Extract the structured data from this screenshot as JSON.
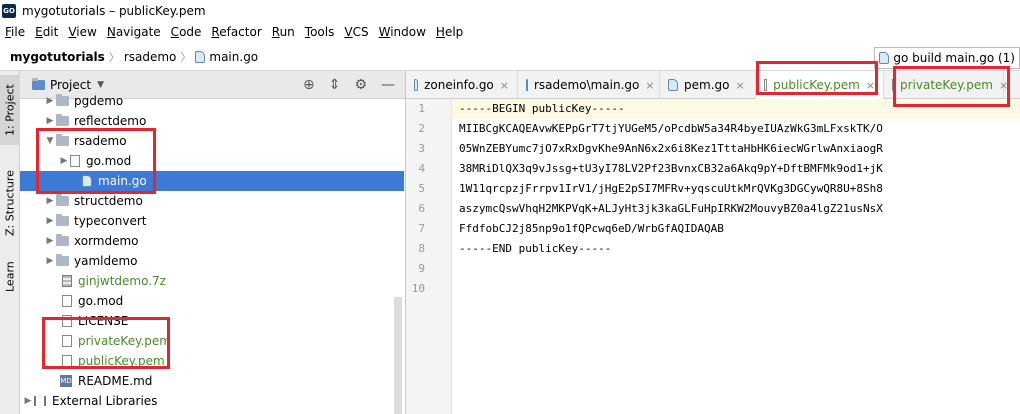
{
  "window": {
    "title": "mygotutorials – publicKey.pem",
    "logo": "GO"
  },
  "menu": [
    "File",
    "Edit",
    "View",
    "Navigate",
    "Code",
    "Refactor",
    "Run",
    "Tools",
    "VCS",
    "Window",
    "Help"
  ],
  "breadcrumb": [
    "mygotutorials",
    "rsademo",
    "main.go"
  ],
  "run_config": "go build main.go (1)",
  "stripe": {
    "project": "1: Project",
    "structure": "Z: Structure",
    "learn": "Learn"
  },
  "project_panel": {
    "title": "Project"
  },
  "tree": [
    {
      "label": "pgdemo",
      "type": "folder"
    },
    {
      "label": "reflectdemo",
      "type": "folder"
    },
    {
      "label": "rsademo",
      "type": "folder"
    },
    {
      "label": "go.mod",
      "type": "file"
    },
    {
      "label": "main.go",
      "type": "go"
    },
    {
      "label": "structdemo",
      "type": "folder"
    },
    {
      "label": "typeconvert",
      "type": "folder"
    },
    {
      "label": "xormdemo",
      "type": "folder"
    },
    {
      "label": "yamldemo",
      "type": "folder"
    },
    {
      "label": "ginjwtdemo.7z",
      "type": "zip"
    },
    {
      "label": "go.mod",
      "type": "file"
    },
    {
      "label": "LICENSE",
      "type": "file"
    },
    {
      "label": "privateKey.pem",
      "type": "file"
    },
    {
      "label": "publicKey.pem",
      "type": "file"
    },
    {
      "label": "README.md",
      "type": "md"
    },
    {
      "label": "External Libraries",
      "type": "lib"
    }
  ],
  "tabs": [
    "zoneinfo.go",
    "rsademo\\main.go",
    "pem.go",
    "publicKey.pem",
    "privateKey.pem"
  ],
  "code_lines": [
    "-----BEGIN publicKey-----",
    "MIIBCgKCAQEAvwKEPpGrT7tjYUGeM5/oPcdbW5a34R4byeIUAzWkG3mLFxskTK/O",
    "05WnZEBYumc7jO7xRxDgvKhe9AnN6x2x6i8Kez1TttaHbHK6iecWGrlwAnxiaogR",
    "38MRiDlQX3q9vJssg+tU3yI78LV2Pf23BvnxCB32a6Akq9pY+DftBMFMk9od1+jK",
    "1W11qrcpzjFrrpv1IrV1/jHgE2pSI7MFRv+yqscuUtkMrQVKg3DGCywQR8U+8Sh8",
    "aszymcQswVhqH2MKPVqK+ALJyHt3jk3kaGLFuHpIRKW2MouvyBZ0a4lgZ21usNsX",
    "FfdfobCJ2j85np9o1fQPcwq6eD/WrbGfAQIDAQAB",
    "-----END publicKey-----"
  ],
  "line_numbers": [
    "1",
    "2",
    "3",
    "4",
    "5",
    "6",
    "7",
    "8",
    "9",
    "10"
  ]
}
